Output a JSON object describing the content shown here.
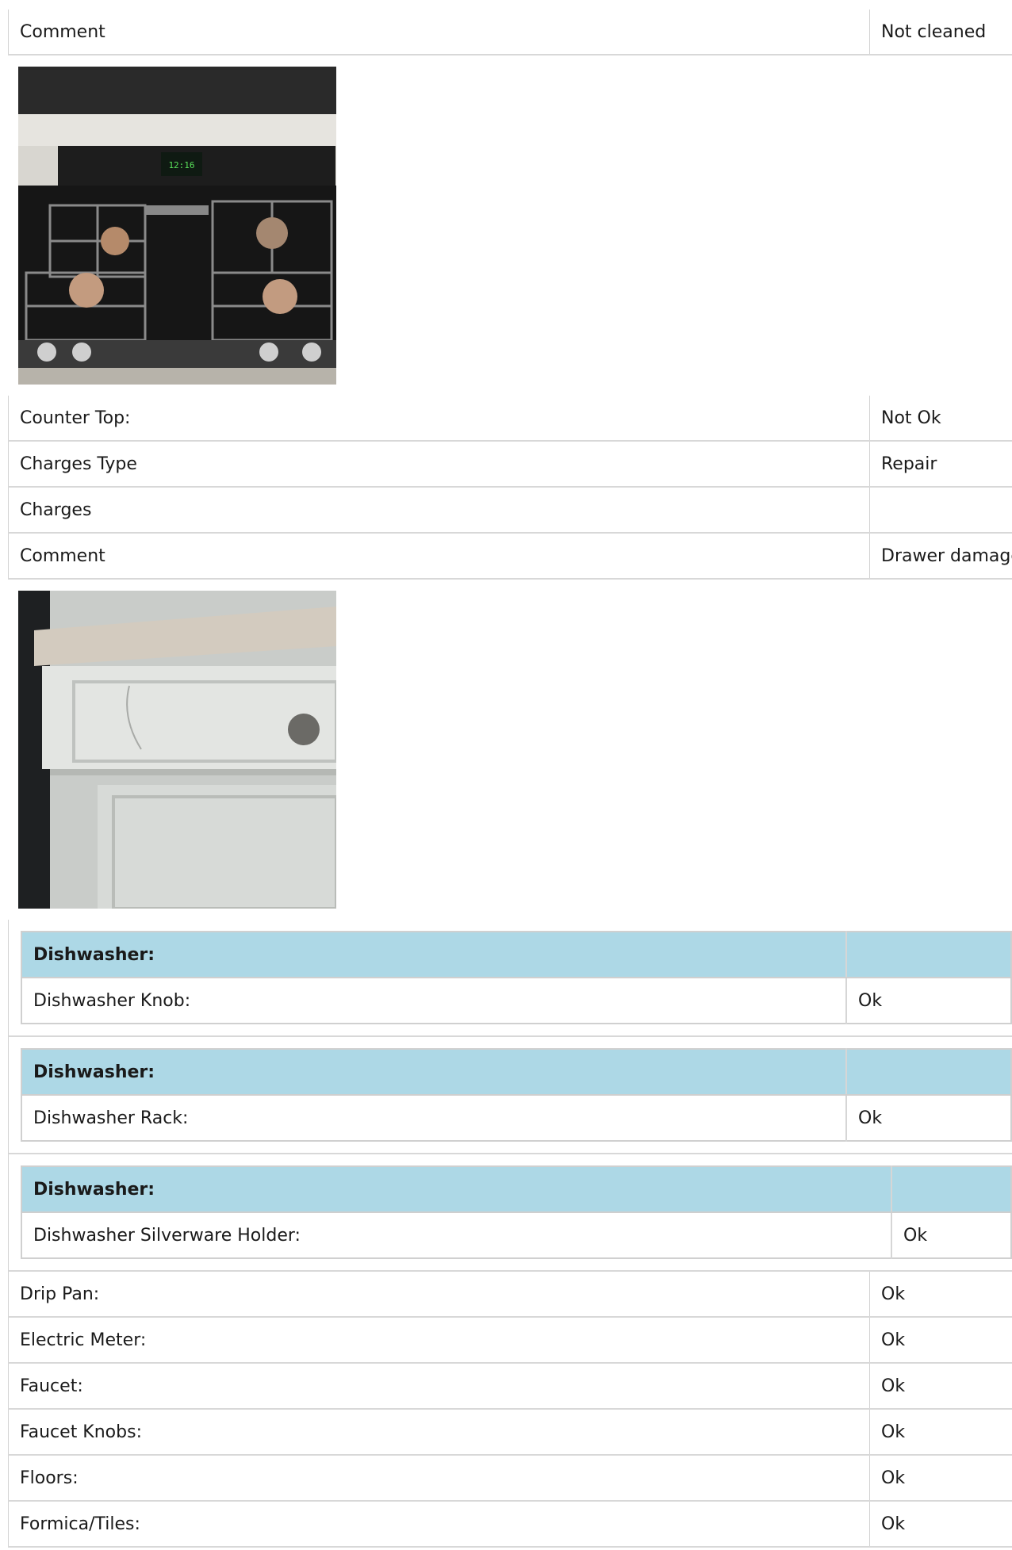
{
  "row_comment_1": {
    "label": "Comment",
    "value": "Not cleaned"
  },
  "photo_stove": {
    "label": "stove-photo",
    "display": "12:16"
  },
  "countertop_rows": [
    {
      "label": "Counter Top:",
      "value": "Not Ok"
    },
    {
      "label": "Charges Type",
      "value": "Repair"
    },
    {
      "label": "Charges",
      "value": ""
    },
    {
      "label": "Comment",
      "value": "Drawer damaged"
    }
  ],
  "dishwasher_sections": [
    {
      "heading": "Dishwasher:",
      "label": "Dishwasher Knob:",
      "value": "Ok"
    },
    {
      "heading": "Dishwasher:",
      "label": "Dishwasher Rack:",
      "value": "Ok"
    },
    {
      "heading": "Dishwasher:",
      "label": "Dishwasher Silverware Holder:",
      "value": "Ok"
    }
  ],
  "items": [
    {
      "label": "Drip Pan:",
      "value": "Ok"
    },
    {
      "label": "Electric Meter:",
      "value": "Ok"
    },
    {
      "label": "Faucet:",
      "value": "Ok"
    },
    {
      "label": "Faucet Knobs:",
      "value": "Ok"
    },
    {
      "label": "Floors:",
      "value": "Ok"
    },
    {
      "label": "Formica/Tiles:",
      "value": "Ok"
    }
  ]
}
